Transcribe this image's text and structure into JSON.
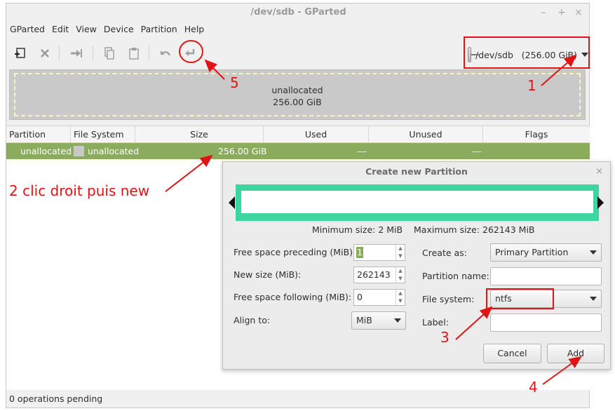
{
  "window": {
    "title": "/dev/sdb - GParted",
    "controls": {
      "minimize": "–",
      "maximize": "+",
      "close": "×"
    }
  },
  "menubar": [
    "GParted",
    "Edit",
    "View",
    "Device",
    "Partition",
    "Help"
  ],
  "toolbar": {
    "buttons": [
      "new-partition-icon",
      "delete-icon",
      "resize-move-icon",
      "copy-icon",
      "paste-icon",
      "undo-icon",
      "apply-icon"
    ]
  },
  "device_selector": {
    "label": "/dev/sdb   (256.00 GiB)",
    "icon": "disk-icon"
  },
  "partition_visual": {
    "name": "unallocated",
    "size": "256.00 GiB"
  },
  "table": {
    "columns": [
      "Partition",
      "File System",
      "Size",
      "Used",
      "Unused",
      "Flags"
    ],
    "rows": [
      {
        "partition": "unallocated",
        "filesystem": "unallocated",
        "size": "256.00 GiB",
        "used": "---",
        "unused": "---",
        "flags": ""
      }
    ]
  },
  "status": {
    "operations": "0 operations pending"
  },
  "dialog": {
    "title": "Create new Partition",
    "close": "×",
    "min_size": "Minimum size: 2 MiB",
    "max_size": "Maximum size: 262143 MiB",
    "fields": {
      "free_before_label": "Free space preceding (MiB):",
      "free_before_value": "1",
      "new_size_label": "New size (MiB):",
      "new_size_value": "262143",
      "free_after_label": "Free space following (MiB):",
      "free_after_value": "0",
      "align_label": "Align to:",
      "align_value": "MiB",
      "create_as_label": "Create as:",
      "create_as_value": "Primary Partition",
      "part_name_label": "Partition name:",
      "part_name_value": "",
      "fs_label": "File system:",
      "fs_value": "ntfs",
      "label_label": "Label:",
      "label_value": ""
    },
    "buttons": {
      "cancel": "Cancel",
      "add": "Add"
    },
    "bar_color": "#3dd6a0"
  },
  "annotations": {
    "n1": "1",
    "n2": "2 clic droit puis new",
    "n3": "3",
    "n4": "4",
    "n5": "5",
    "color": "#e01414"
  },
  "colors": {
    "selected_row": "#8bab5d",
    "partition_bg": "#c9c9c9"
  }
}
